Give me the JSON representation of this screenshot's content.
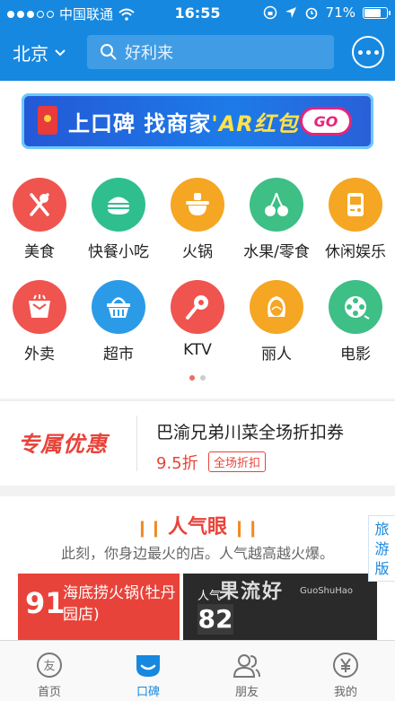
{
  "status_bar": {
    "carrier": "中国联通",
    "time": "16:55",
    "battery": "71%"
  },
  "header": {
    "city": "北京",
    "search_placeholder": "好利来"
  },
  "banner": {
    "text_main": "上口碑 找商家",
    "text_ar": "'AR红包",
    "go": "GO"
  },
  "categories": [
    {
      "label": "美食",
      "icon": "fork-knife-icon",
      "color": "#f0544f"
    },
    {
      "label": "快餐小吃",
      "icon": "burger-icon",
      "color": "#2fbf8f"
    },
    {
      "label": "火锅",
      "icon": "hotpot-icon",
      "color": "#f5a623"
    },
    {
      "label": "水果/零食",
      "icon": "cherry-icon",
      "color": "#3dbf86"
    },
    {
      "label": "休闲娱乐",
      "icon": "gameboy-icon",
      "color": "#f5a623"
    },
    {
      "label": "外卖",
      "icon": "takeout-box-icon",
      "color": "#f0544f"
    },
    {
      "label": "超市",
      "icon": "basket-icon",
      "color": "#2b9be8"
    },
    {
      "label": "KTV",
      "icon": "microphone-icon",
      "color": "#f0544f"
    },
    {
      "label": "丽人",
      "icon": "face-icon",
      "color": "#f5a623"
    },
    {
      "label": "电影",
      "icon": "film-reel-icon",
      "color": "#3dbf86"
    }
  ],
  "coupon": {
    "brand": "专属优惠",
    "title": "巴渝兄弟川菜全场折扣券",
    "price": "9.5折",
    "tag": "全场折扣"
  },
  "popular": {
    "title": "人气眼",
    "subtitle": "此刻，你身边最火的店。人气越高越火爆。",
    "card1": {
      "rank": "91",
      "name": "海底捞火锅(牡丹园店)"
    },
    "card2": {
      "label": "人气",
      "rank": "82",
      "sign": "果流好",
      "sign2": "GuoShuHao"
    }
  },
  "travel": "旅游版",
  "tabs": [
    {
      "label": "首页",
      "icon": "home-friend-icon",
      "active": false
    },
    {
      "label": "口碑",
      "icon": "koubei-icon",
      "active": true
    },
    {
      "label": "朋友",
      "icon": "friends-icon",
      "active": false
    },
    {
      "label": "我的",
      "icon": "yen-icon",
      "active": false
    }
  ]
}
